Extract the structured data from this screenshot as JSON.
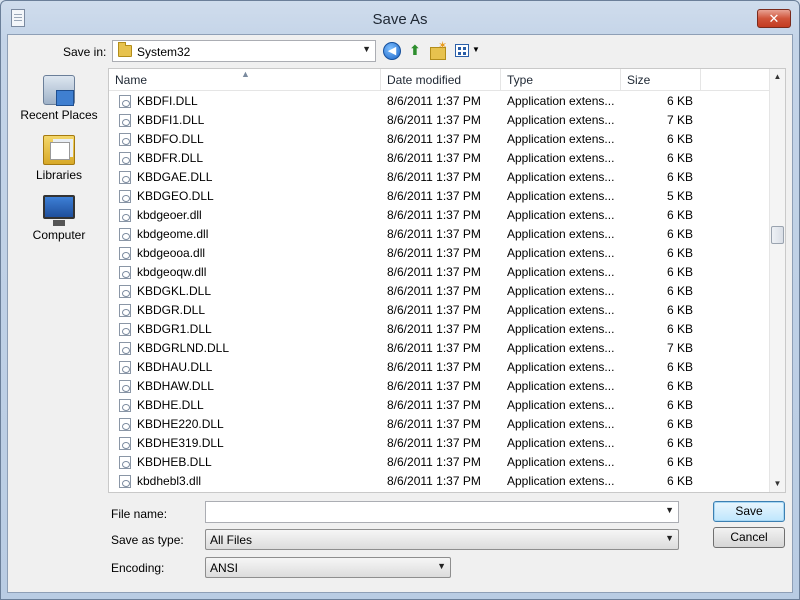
{
  "window": {
    "title": "Save As",
    "close_glyph": "✕"
  },
  "toolbar": {
    "save_in_label": "Save in:",
    "save_in_value": "System32",
    "icons": [
      "back-icon",
      "up-folder-icon",
      "new-folder-icon",
      "view-menu-icon"
    ]
  },
  "places": [
    {
      "label": "Recent Places",
      "icon": "recent-places-icon"
    },
    {
      "label": "Libraries",
      "icon": "libraries-icon"
    },
    {
      "label": "Computer",
      "icon": "computer-icon"
    }
  ],
  "columns": {
    "name": "Name",
    "date": "Date modified",
    "type": "Type",
    "size": "Size"
  },
  "files": [
    {
      "name": "KBDFI.DLL",
      "date": "8/6/2011 1:37 PM",
      "type": "Application extens...",
      "size": "6 KB"
    },
    {
      "name": "KBDFI1.DLL",
      "date": "8/6/2011 1:37 PM",
      "type": "Application extens...",
      "size": "7 KB"
    },
    {
      "name": "KBDFO.DLL",
      "date": "8/6/2011 1:37 PM",
      "type": "Application extens...",
      "size": "6 KB"
    },
    {
      "name": "KBDFR.DLL",
      "date": "8/6/2011 1:37 PM",
      "type": "Application extens...",
      "size": "6 KB"
    },
    {
      "name": "KBDGAE.DLL",
      "date": "8/6/2011 1:37 PM",
      "type": "Application extens...",
      "size": "6 KB"
    },
    {
      "name": "KBDGEO.DLL",
      "date": "8/6/2011 1:37 PM",
      "type": "Application extens...",
      "size": "5 KB"
    },
    {
      "name": "kbdgeoer.dll",
      "date": "8/6/2011 1:37 PM",
      "type": "Application extens...",
      "size": "6 KB"
    },
    {
      "name": "kbdgeome.dll",
      "date": "8/6/2011 1:37 PM",
      "type": "Application extens...",
      "size": "6 KB"
    },
    {
      "name": "kbdgeooa.dll",
      "date": "8/6/2011 1:37 PM",
      "type": "Application extens...",
      "size": "6 KB"
    },
    {
      "name": "kbdgeoqw.dll",
      "date": "8/6/2011 1:37 PM",
      "type": "Application extens...",
      "size": "6 KB"
    },
    {
      "name": "KBDGKL.DLL",
      "date": "8/6/2011 1:37 PM",
      "type": "Application extens...",
      "size": "6 KB"
    },
    {
      "name": "KBDGR.DLL",
      "date": "8/6/2011 1:37 PM",
      "type": "Application extens...",
      "size": "6 KB"
    },
    {
      "name": "KBDGR1.DLL",
      "date": "8/6/2011 1:37 PM",
      "type": "Application extens...",
      "size": "6 KB"
    },
    {
      "name": "KBDGRLND.DLL",
      "date": "8/6/2011 1:37 PM",
      "type": "Application extens...",
      "size": "7 KB"
    },
    {
      "name": "KBDHAU.DLL",
      "date": "8/6/2011 1:37 PM",
      "type": "Application extens...",
      "size": "6 KB"
    },
    {
      "name": "KBDHAW.DLL",
      "date": "8/6/2011 1:37 PM",
      "type": "Application extens...",
      "size": "6 KB"
    },
    {
      "name": "KBDHE.DLL",
      "date": "8/6/2011 1:37 PM",
      "type": "Application extens...",
      "size": "6 KB"
    },
    {
      "name": "KBDHE220.DLL",
      "date": "8/6/2011 1:37 PM",
      "type": "Application extens...",
      "size": "6 KB"
    },
    {
      "name": "KBDHE319.DLL",
      "date": "8/6/2011 1:37 PM",
      "type": "Application extens...",
      "size": "6 KB"
    },
    {
      "name": "KBDHEB.DLL",
      "date": "8/6/2011 1:37 PM",
      "type": "Application extens...",
      "size": "6 KB"
    },
    {
      "name": "kbdhebl3.dll",
      "date": "8/6/2011 1:37 PM",
      "type": "Application extens...",
      "size": "6 KB"
    }
  ],
  "form": {
    "file_name_label": "File name:",
    "file_name_value": "",
    "save_type_label": "Save as type:",
    "save_type_value": "All Files",
    "encoding_label": "Encoding:",
    "encoding_value": "ANSI"
  },
  "buttons": {
    "save": "Save",
    "cancel": "Cancel"
  },
  "colors": {
    "accent": "#3c7fb1",
    "close": "#c33b20",
    "folder": "#e7c24e"
  }
}
